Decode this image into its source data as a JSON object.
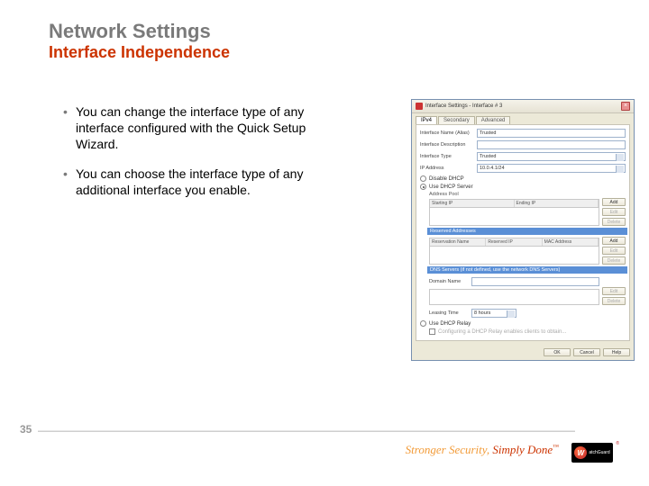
{
  "title": "Network Settings",
  "subtitle": "Interface Independence",
  "bullets": [
    "You can change the interface type of any interface configured with the Quick Setup Wizard.",
    "You can choose the interface type of any additional interface you enable."
  ],
  "dialog": {
    "title": "Interface Settings - Interface # 3",
    "tabs": [
      "IPv4",
      "Secondary",
      "Advanced"
    ],
    "fields": {
      "name_label": "Interface Name (Alias)",
      "name_value": "Trusted",
      "desc_label": "Interface Description",
      "desc_value": "",
      "type_label": "Interface Type",
      "type_value": "Trusted",
      "ip_label": "IP Address",
      "ip_value": "10.0.4.1/24"
    },
    "radios": {
      "disable": "Disable DHCP",
      "use": "Use DHCP Server"
    },
    "pool": {
      "header": "Address Pool",
      "cols": [
        "Starting IP",
        "Ending IP"
      ]
    },
    "reserve": {
      "header": "Reserved Addresses",
      "cols": [
        "Reservation Name",
        "Reserved IP",
        "MAC Address"
      ]
    },
    "dns": {
      "header": "DNS Servers (if not defined, use the network DNS Servers)",
      "domain_label": "Domain Name"
    },
    "lease": {
      "label": "Leasing Time",
      "value": "8 hours"
    },
    "relay": {
      "label": "Use DHCP Relay",
      "hint": "Configuring a DHCP Relay enables clients to obtain..."
    },
    "btns": {
      "add": "Add",
      "edit": "Edit",
      "delete": "Delete",
      "ok": "OK",
      "cancel": "Cancel",
      "help": "Help"
    }
  },
  "page_number": "35",
  "tagline": {
    "a": "Stronger Security, ",
    "b": "Simply Done"
  },
  "logo": {
    "mark": "W",
    "text": "atchGuard"
  }
}
